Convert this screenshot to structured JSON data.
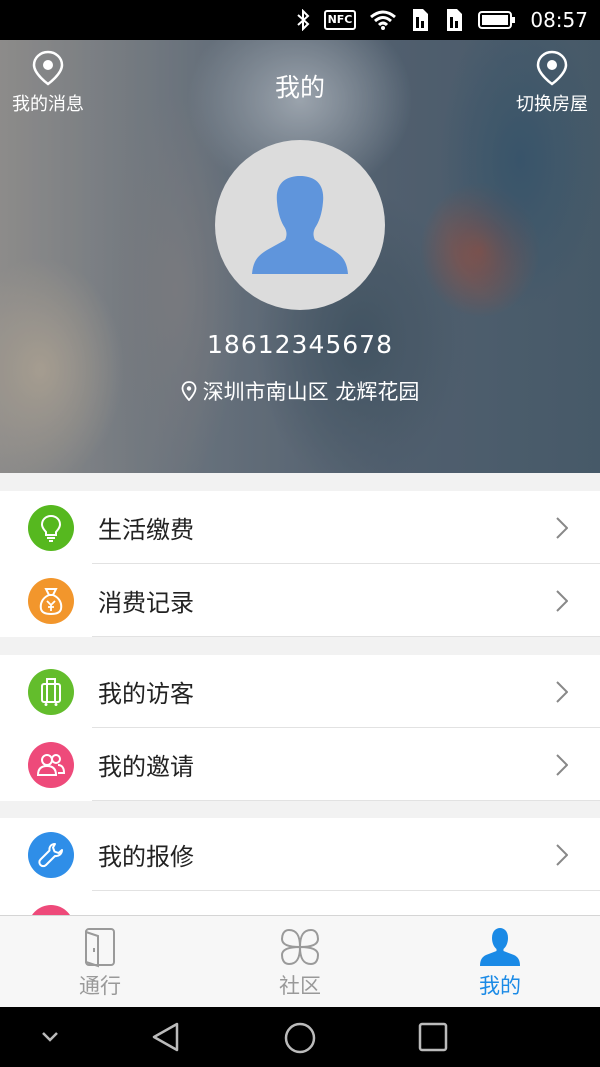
{
  "status_bar": {
    "time": "08:57",
    "nfc": "NFC"
  },
  "header": {
    "title": "我的",
    "left_action": "我的消息",
    "right_action": "切换房屋",
    "phone": "18612345678",
    "address": "深圳市南山区 龙辉花园"
  },
  "menu": {
    "groups": [
      {
        "items": [
          {
            "label": "生活缴费",
            "icon": "lightbulb-icon",
            "color": "#56b81f"
          },
          {
            "label": "消费记录",
            "icon": "money-bag-icon",
            "color": "#f2962c"
          }
        ]
      },
      {
        "items": [
          {
            "label": "我的访客",
            "icon": "luggage-icon",
            "color": "#63bd2c"
          },
          {
            "label": "我的邀请",
            "icon": "people-icon",
            "color": "#ee4a7a"
          }
        ]
      },
      {
        "items": [
          {
            "label": "我的报修",
            "icon": "wrench-icon",
            "color": "#2f8ee8"
          }
        ]
      }
    ]
  },
  "tabbar": {
    "tabs": [
      {
        "label": "通行",
        "icon": "door-icon"
      },
      {
        "label": "社区",
        "icon": "community-icon"
      },
      {
        "label": "我的",
        "icon": "user-icon",
        "active": true
      }
    ],
    "active_color": "#1a8ae6",
    "inactive_color": "#999999"
  }
}
